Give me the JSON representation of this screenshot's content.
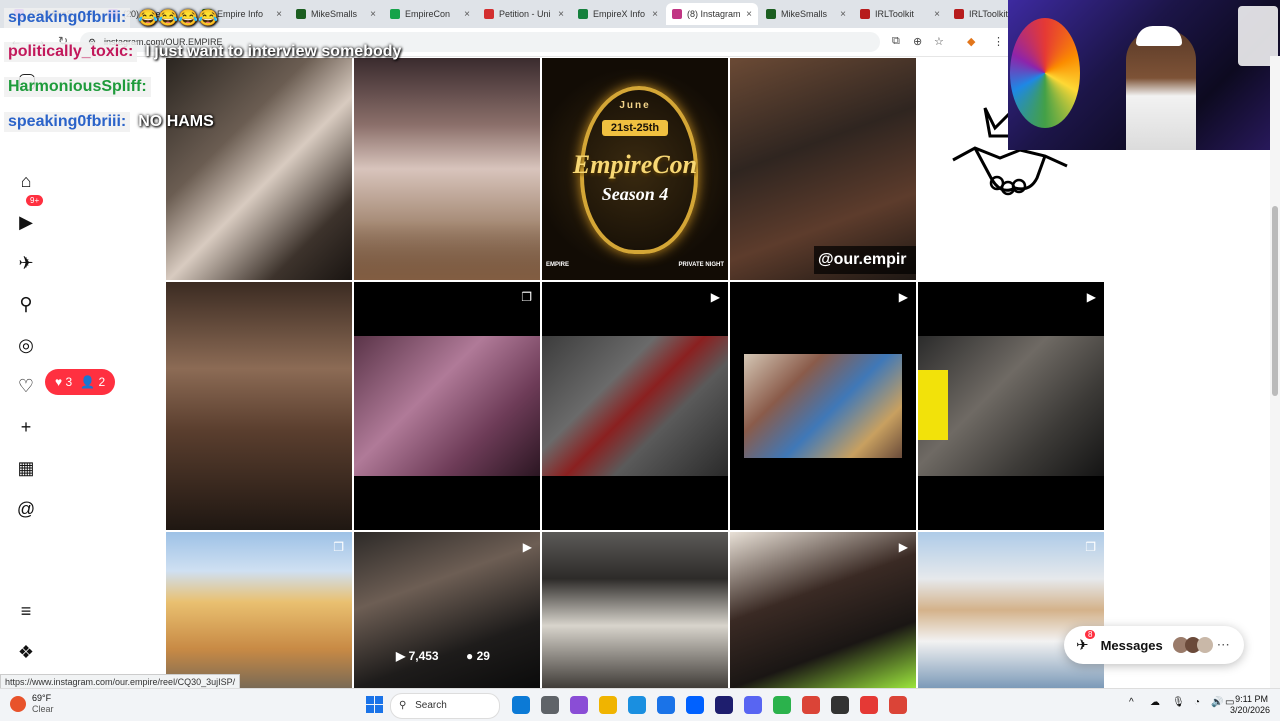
{
  "browser": {
    "tabs": [
      {
        "label": "(20) MikeS",
        "color": "#9147ff"
      },
      {
        "label": "(20) MikeS",
        "color": "#9147ff"
      },
      {
        "label": "Empire Info",
        "color": "#2e7d32"
      },
      {
        "label": "MikeSmalls",
        "color": "#1b5e20"
      },
      {
        "label": "EmpireCon",
        "color": "#16a34a"
      },
      {
        "label": "Petition - Uni",
        "color": "#d32f2f"
      },
      {
        "label": "EmpireX Info",
        "color": "#15803d"
      },
      {
        "label": "(8) Instagram",
        "color": "#c13584"
      },
      {
        "label": "MikeSmalls",
        "color": "#1b5e20"
      },
      {
        "label": "IRLToolkit",
        "color": "#b71c1c"
      },
      {
        "label": "IRLToolkit R",
        "color": "#b71c1c"
      }
    ],
    "url": "instagram.com/OUR.EMPIRE",
    "status_url": "https://www.instagram.com/our.empire/reel/CQ30_3ujISP/"
  },
  "sidebar": {
    "items": [
      {
        "icon": "home-icon",
        "glyph": "⌂"
      },
      {
        "icon": "reels-icon",
        "glyph": "▶"
      },
      {
        "icon": "messenger-icon",
        "glyph": "✈"
      },
      {
        "icon": "search-icon",
        "glyph": "⚲"
      },
      {
        "icon": "explore-icon",
        "glyph": "◎"
      },
      {
        "icon": "heart-icon",
        "glyph": "♡"
      },
      {
        "icon": "create-icon",
        "glyph": "+"
      },
      {
        "icon": "dashboard-icon",
        "glyph": "▦"
      },
      {
        "icon": "threads-icon",
        "glyph": "@"
      },
      {
        "icon": "menu-icon",
        "glyph": "≡"
      },
      {
        "icon": "more-apps-icon",
        "glyph": "❖"
      }
    ],
    "messenger_badge": "9+",
    "notifications": {
      "likes": "3",
      "follows": "2"
    }
  },
  "chat": [
    {
      "user": "speaking0fbriii:",
      "message": "😂😂😂😂",
      "user_color": "#2b63c9"
    },
    {
      "user": "politically_toxic:",
      "message": "I just want to interview somebody",
      "user_color": "#c2185b"
    },
    {
      "user": "HarmoniousSpliff:",
      "message": "",
      "user_color": "#1e9b3b"
    },
    {
      "user": "speaking0fbriii:",
      "message": "NO HAMS",
      "user_color": "#2b63c9"
    }
  ],
  "grid": {
    "banner_lines": [
      "June",
      "21st-25th",
      "EmpireCon",
      "Season 4"
    ],
    "banner_footer_left": "EMPIRE",
    "banner_footer_right": "PRIVATE NIGHT",
    "handle_tag": "@our.empir",
    "reel_views": "7,453",
    "reel_comments": "29"
  },
  "messages": {
    "label": "Messages",
    "badge": "8"
  },
  "taskbar": {
    "weather_temp": "69°F",
    "weather_desc": "Clear",
    "search_placeholder": "Search",
    "time": "9:11 PM",
    "date": "3/20/2026"
  }
}
